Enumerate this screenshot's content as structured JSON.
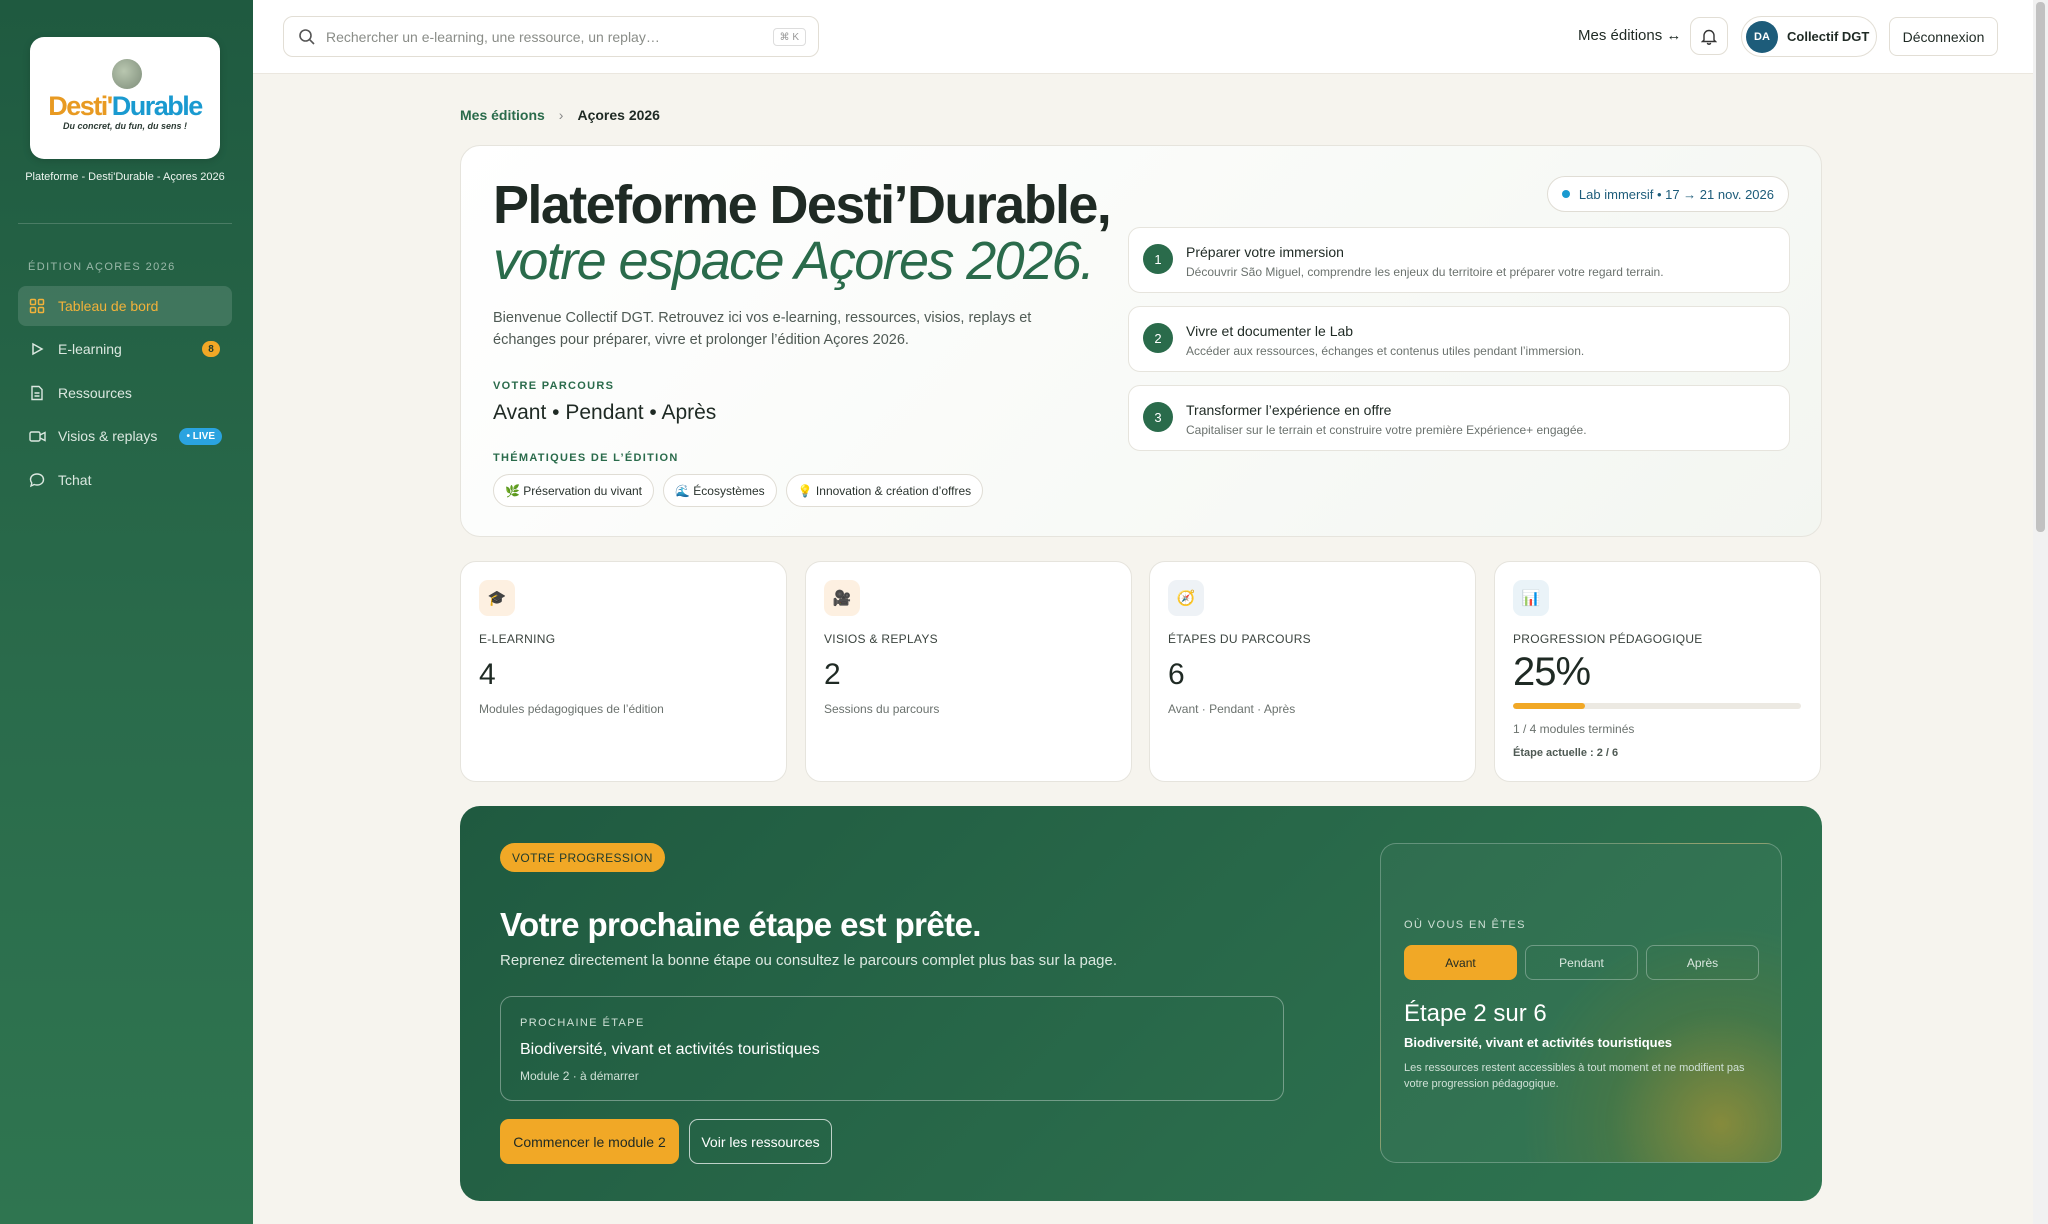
{
  "sidebar": {
    "logo": {
      "brand_part1": "Desti'",
      "brand_part2": "Durable",
      "tagline": "Du concret, du fun, du sens !"
    },
    "caption": "Plateforme - Desti'Durable - Açores 2026",
    "section_title": "ÉDITION AÇORES 2026",
    "items": [
      {
        "label": "Tableau de bord",
        "icon": "dashboard-icon",
        "active": true
      },
      {
        "label": "E-learning",
        "icon": "play-icon",
        "badge": "8"
      },
      {
        "label": "Ressources",
        "icon": "document-icon"
      },
      {
        "label": "Visios & replays",
        "icon": "video-icon",
        "badge": "• LIVE"
      },
      {
        "label": "Tchat",
        "icon": "chat-icon"
      }
    ]
  },
  "topbar": {
    "search_placeholder": "Rechercher un e-learning, une ressource, un replay…",
    "search_shortcut": "⌘ K",
    "editions_link": "Mes éditions ↔",
    "avatar_initials": "DA",
    "user_name": "Collectif DGT",
    "logout_label": "Déconnexion"
  },
  "breadcrumb": {
    "parent": "Mes éditions",
    "separator": "›",
    "current": "Açores 2026"
  },
  "hero": {
    "title_line1": "Plateforme Desti’Durable,",
    "title_line2": "votre espace Açores 2026.",
    "intro": "Bienvenue Collectif DGT. Retrouvez ici vos e-learning, ressources, visios, replays et échanges pour préparer, vivre et prolonger l’édition Açores 2026.",
    "parcours_label": "VOTRE PARCOURS",
    "parcours_phases": "Avant • Pendant • Après",
    "themes_label": "THÉMATIQUES DE L’ÉDITION",
    "themes": [
      "🌿 Préservation du vivant",
      "🌊 Écosystèmes",
      "💡 Innovation & création d’offres"
    ],
    "lab_pill": "Lab immersif • 17 → 21 nov. 2026",
    "steps": [
      {
        "num": "1",
        "title": "Préparer votre immersion",
        "desc": "Découvrir São Miguel, comprendre les enjeux du territoire et préparer votre regard terrain."
      },
      {
        "num": "2",
        "title": "Vivre et documenter le Lab",
        "desc": "Accéder aux ressources, échanges et contenus utiles pendant l’immersion."
      },
      {
        "num": "3",
        "title": "Transformer l’expérience en offre",
        "desc": "Capitaliser sur le terrain et construire votre première Expérience+ engagée."
      }
    ]
  },
  "stats": [
    {
      "icon": "🎓",
      "icon_name": "graduation-cap-icon",
      "icon_bg": "#fdf0e1",
      "label": "E-LEARNING",
      "value": "4",
      "desc": "Modules pédagogiques de l’édition"
    },
    {
      "icon": "🎥",
      "icon_name": "camera-icon",
      "icon_bg": "#fdf0e1",
      "label": "VISIOS & REPLAYS",
      "value": "2",
      "desc": "Sessions du parcours"
    },
    {
      "icon": "🧭",
      "icon_name": "compass-icon",
      "icon_bg": "#eef2f6",
      "label": "ÉTAPES DU PARCOURS",
      "value": "6",
      "desc": "Avant · Pendant · Après"
    },
    {
      "icon": "📊",
      "icon_name": "chart-icon",
      "icon_bg": "#eaf3f8",
      "label": "PROGRESSION PÉDAGOGIQUE",
      "value": "25%",
      "progress": 0.25,
      "sub": "1 / 4 modules terminés",
      "current_step": "Étape actuelle : 2 / 6"
    }
  ],
  "progress_panel": {
    "pill": "VOTRE PROGRESSION",
    "title": "Votre prochaine étape est prête.",
    "subtitle": "Reprenez directement la bonne étape ou consultez le parcours complet plus bas sur la page.",
    "next_label": "PROCHAINE ÉTAPE",
    "next_title": "Biodiversité, vivant et activités touristiques",
    "next_meta": "Module 2 · à démarrer",
    "primary_btn": "Commencer le module 2",
    "secondary_btn": "Voir les ressources",
    "where_label": "OÙ VOUS EN ÊTES",
    "phases": [
      {
        "label": "Avant",
        "active": true
      },
      {
        "label": "Pendant",
        "active": false
      },
      {
        "label": "Après",
        "active": false
      }
    ],
    "step_text": "Étape 2 sur 6",
    "step_topic": "Biodiversité, vivant et activités touristiques",
    "step_note": "Les ressources restent accessibles à tout moment et ne modifient pas votre progression pédagogique."
  },
  "colors": {
    "brand_green": "#2a6b4b",
    "accent_orange": "#f1a826",
    "live_blue": "#2aa3e0"
  }
}
